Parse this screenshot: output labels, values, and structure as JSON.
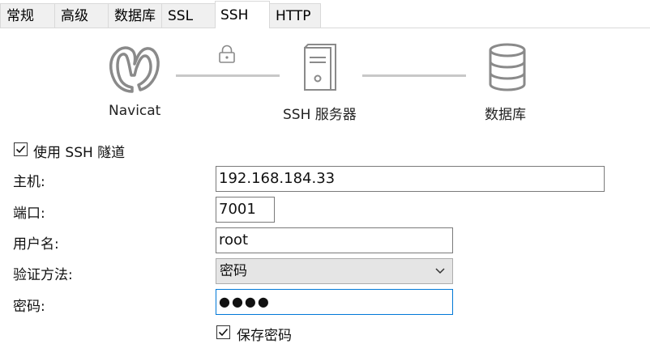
{
  "tabs": [
    {
      "label": "常规",
      "active": false
    },
    {
      "label": "高级",
      "active": false
    },
    {
      "label": "数据库",
      "active": false
    },
    {
      "label": "SSL",
      "active": false
    },
    {
      "label": "SSH",
      "active": true
    },
    {
      "label": "HTTP",
      "active": false
    }
  ],
  "diagram": {
    "client_label": "Navicat",
    "server_label": "SSH 服务器",
    "database_label": "数据库",
    "icons": [
      "navicat-logo-icon",
      "lock-icon",
      "server-icon",
      "database-icon"
    ]
  },
  "ssh_tunnel": {
    "label": "使用 SSH 隧道",
    "checked": true
  },
  "form": {
    "host_label": "主机:",
    "host_value": "192.168.184.33",
    "port_label": "端口:",
    "port_value": "7001",
    "user_label": "用户名:",
    "user_value": "root",
    "auth_label": "验证方法:",
    "auth_value": "密码",
    "password_label": "密码:",
    "password_mask": "●●●●"
  },
  "save_password": {
    "label": "保存密码",
    "checked": true
  },
  "colors": {
    "focus_border": "#0078d7",
    "icon_gray": "#8a8a8a",
    "connector_gray": "#c8c8c8"
  }
}
